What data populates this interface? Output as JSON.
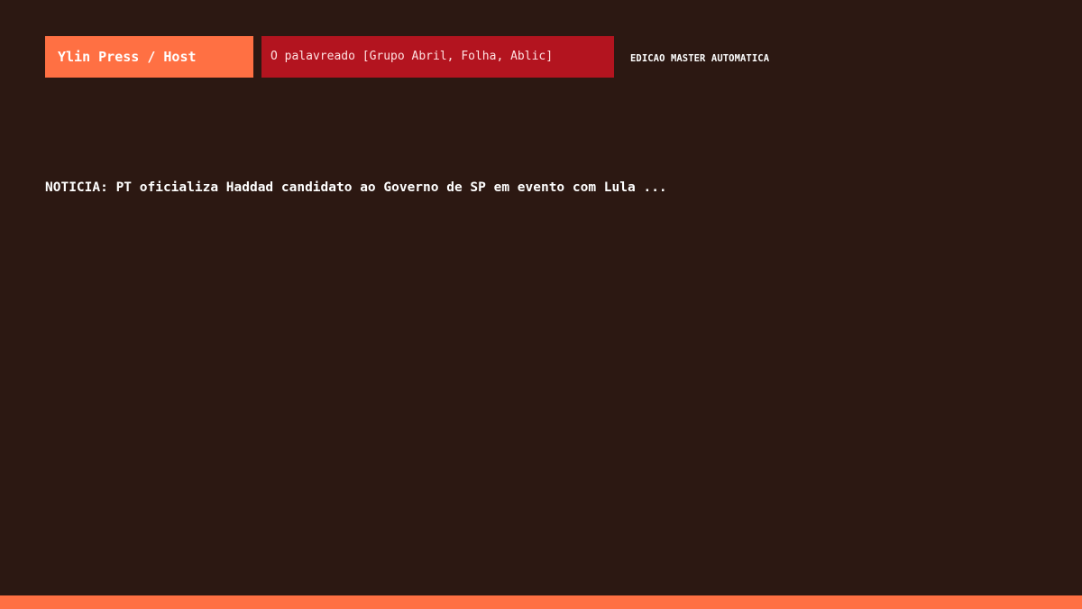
{
  "header": {
    "brand_label": "Ylin Press / Host",
    "search_value": "O palavreado [Grupo Abril, Folha, Ablic]",
    "edition_label": "EDICAO MASTER AUTOMATICA"
  },
  "news": {
    "headline": "NOTICIA: PT oficializa Haddad candidato ao Governo de SP em evento com Lula ..."
  },
  "colors": {
    "background": "#2c1812",
    "accent": "#ff7043",
    "search_background": "#b3141f",
    "text": "#ffffff"
  }
}
